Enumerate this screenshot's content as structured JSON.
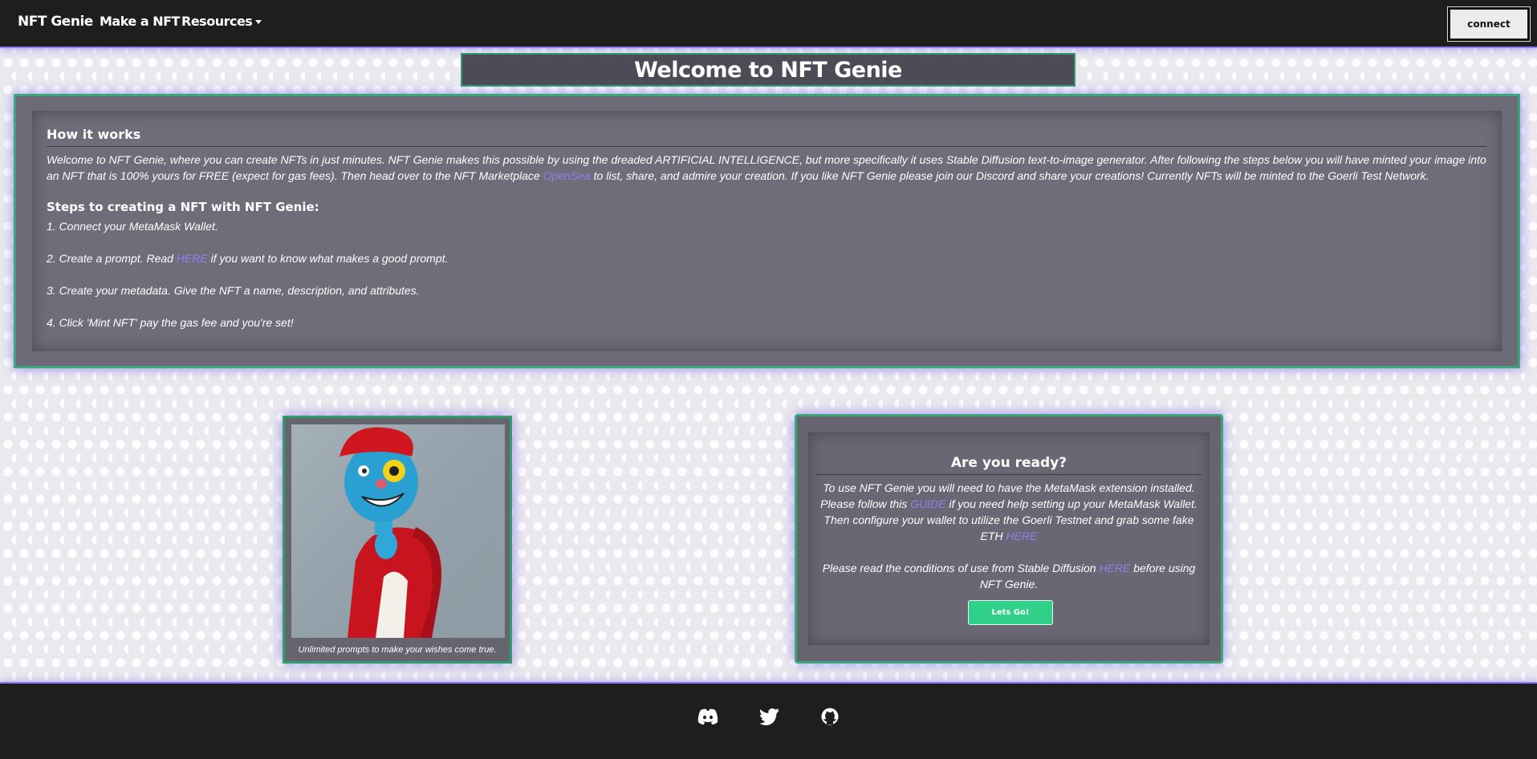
{
  "nav": {
    "brand": "NFT Genie",
    "make_nft": "Make a NFT",
    "resources": "Resources",
    "connect": "connect"
  },
  "colors": {
    "accent_purple": "#8a7cf0",
    "accent_green": "#38a878",
    "button_green": "#2fd08a",
    "link": "#8c82ef",
    "card_bg": "#6b6a76",
    "nav_bg": "#1e1e1f"
  },
  "page_title": "Welcome to NFT Genie",
  "how_it_works": {
    "title": "How it works",
    "intro_before_link": "Welcome to NFT Genie, where you can create NFTs in just minutes. NFT Genie makes this possible by using the dreaded ARTIFICIAL INTELLIGENCE, but more specifically it uses Stable Diffusion text-to-image generator. After following the steps below you will have minted your image into an NFT that is 100% yours for FREE (expect for gas fees). Then head over to the NFT Marketplace ",
    "opensea_link": "OpenSea",
    "intro_after_link": " to list, share, and admire your creation. If you like NFT Genie please join our Discord and share your creations! Currently NFTs will be minted to the Goerli Test Network.",
    "steps_title": "Steps to creating a NFT with NFT Genie:",
    "step1": "1. Connect your MetaMask Wallet.",
    "step2_before": "2. Create a prompt. Read ",
    "step2_link": "HERE",
    "step2_after": " if you want to know what makes a good prompt.",
    "step3": "3. Create your metadata. Give the NFT a name, description, and attributes.",
    "step4": "4. Click 'Mint NFT' pay the gas fee and you're set!"
  },
  "image_card": {
    "caption": "Unlimited prompts to make your wishes come true."
  },
  "ready_card": {
    "title": "Are you ready?",
    "p1_a": "To use NFT Genie you will need to have the MetaMask extension installed. Please follow this ",
    "p1_guide": "GUIDE",
    "p1_b": " if you need help setting up your MetaMask Wallet. Then configure your wallet to utilize the Goerli Testnet and grab some fake ETH ",
    "p1_here": "HERE",
    "p2_a": "Please read the conditions of use from Stable Diffusion ",
    "p2_here": "HERE",
    "p2_b": " before using NFT Genie.",
    "button": "Lets Go!"
  },
  "footer": {
    "icons": [
      "discord-icon",
      "twitter-icon",
      "github-icon"
    ]
  }
}
